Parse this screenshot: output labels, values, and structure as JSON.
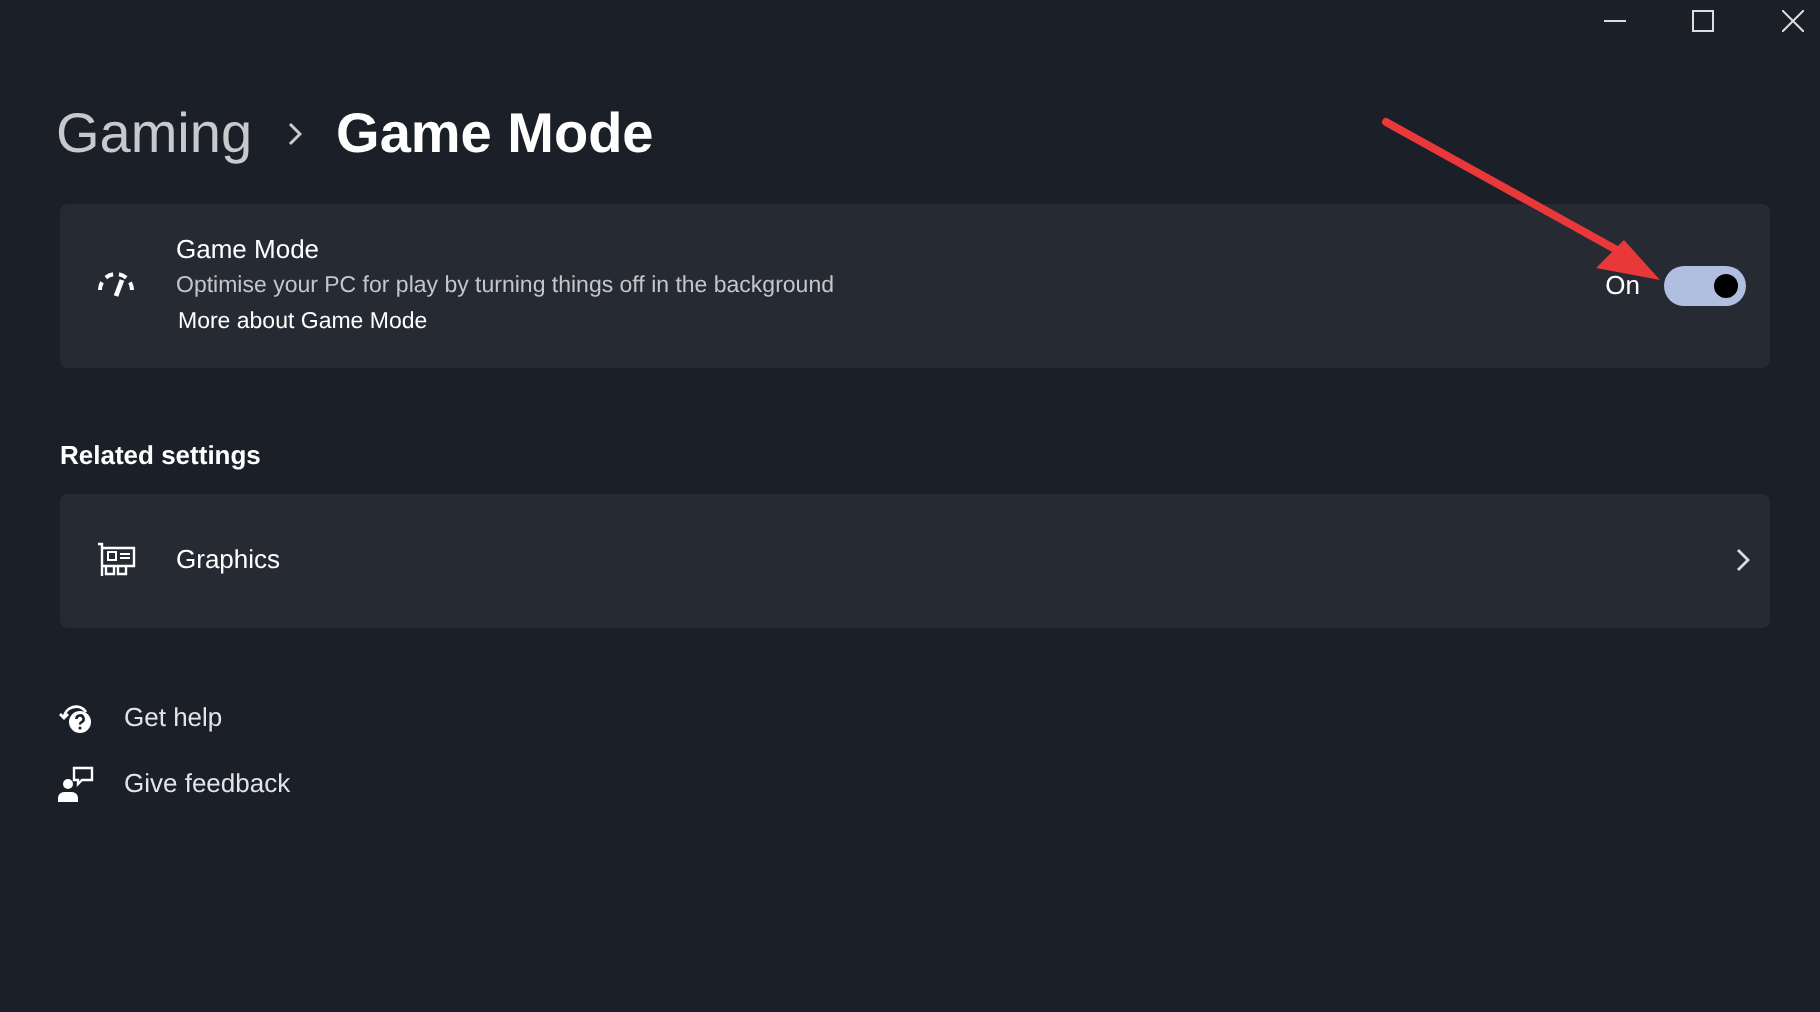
{
  "breadcrumb": {
    "parent": "Gaming",
    "current": "Game Mode"
  },
  "setting": {
    "title": "Game Mode",
    "description": "Optimise your PC for play by turning things off in the background",
    "link": "More about Game Mode",
    "state_label": "On",
    "on": true
  },
  "related": {
    "heading": "Related settings",
    "items": [
      {
        "label": "Graphics"
      }
    ]
  },
  "help_links": [
    {
      "kind": "help",
      "label": "Get help"
    },
    {
      "kind": "feedback",
      "label": "Give feedback"
    }
  ],
  "annotations": [
    {
      "kind": "arrow"
    }
  ]
}
